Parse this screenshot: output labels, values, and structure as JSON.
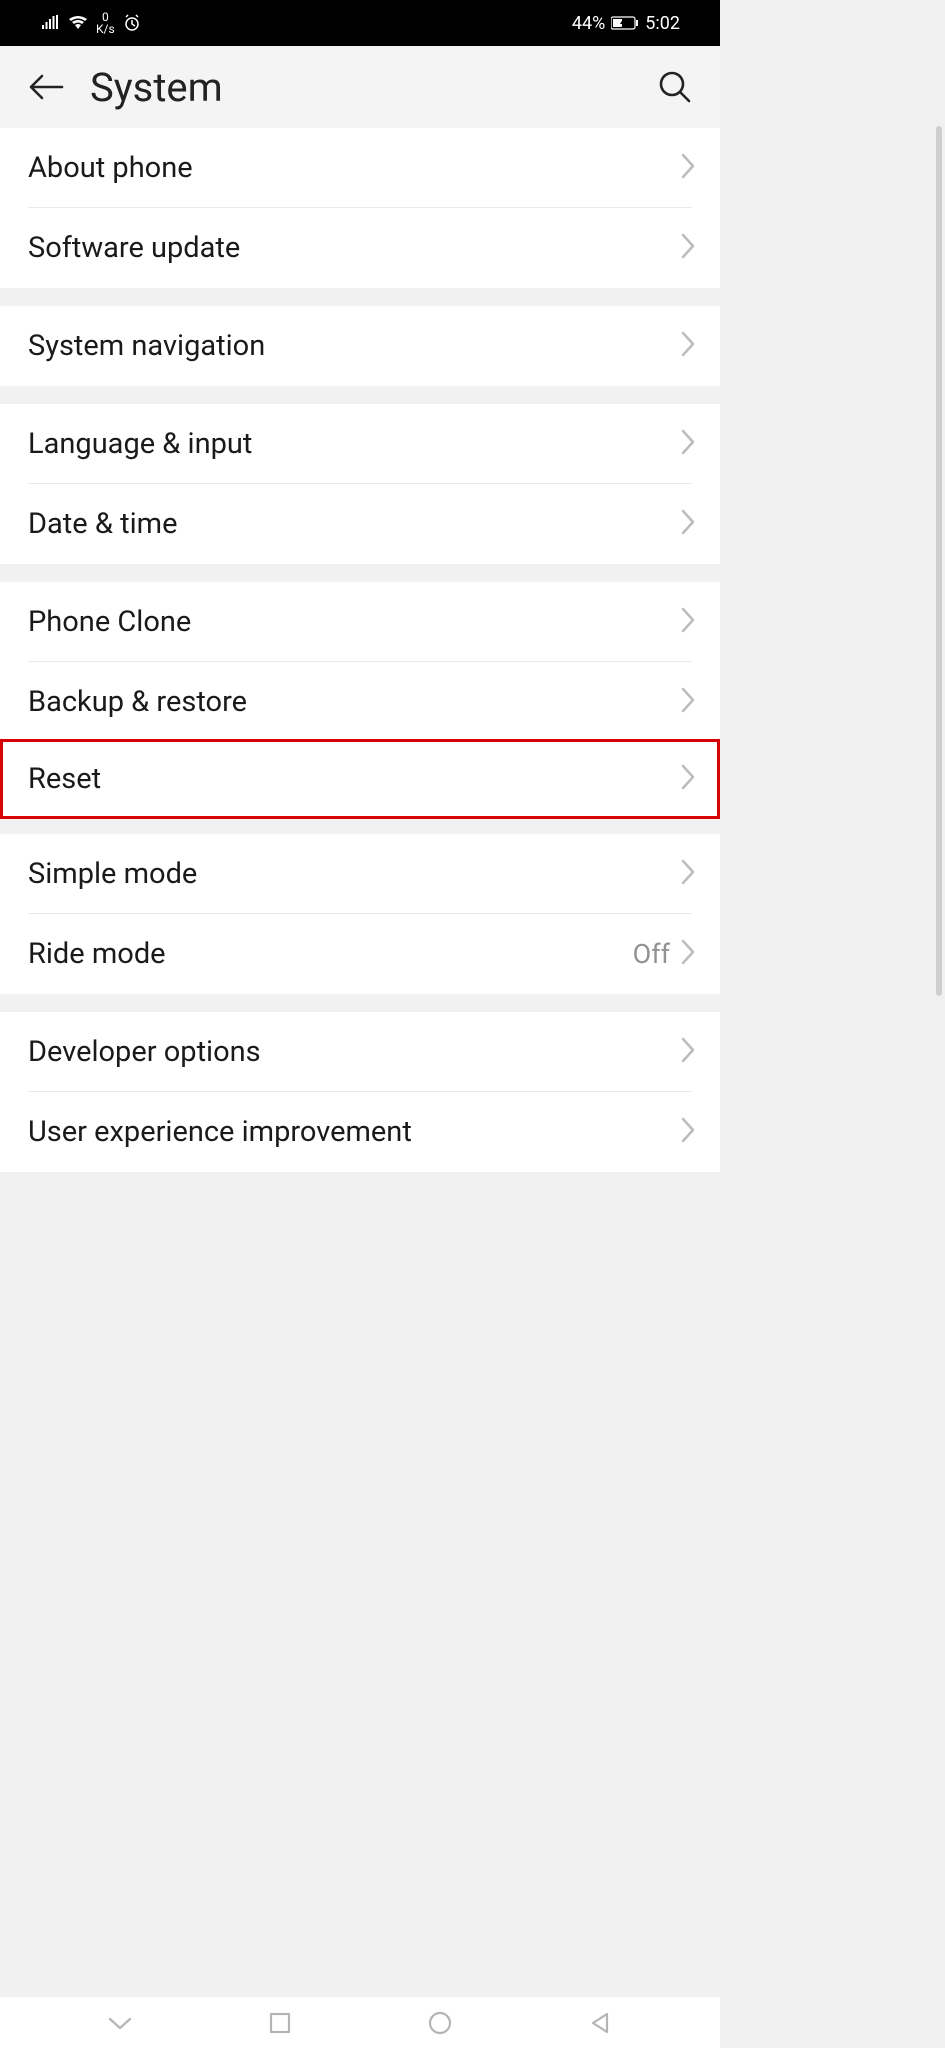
{
  "status_bar": {
    "speed_value": "0",
    "speed_unit": "K/s",
    "battery_percent": "44%",
    "time": "5:02"
  },
  "header": {
    "title": "System"
  },
  "groups": [
    {
      "items": [
        {
          "label": "About phone"
        },
        {
          "label": "Software update"
        }
      ]
    },
    {
      "items": [
        {
          "label": "System navigation"
        }
      ]
    },
    {
      "items": [
        {
          "label": "Language & input"
        },
        {
          "label": "Date & time"
        }
      ]
    },
    {
      "items": [
        {
          "label": "Phone Clone"
        },
        {
          "label": "Backup & restore"
        },
        {
          "label": "Reset"
        }
      ]
    },
    {
      "items": [
        {
          "label": "Simple mode"
        },
        {
          "label": "Ride mode",
          "value": "Off"
        }
      ]
    },
    {
      "items": [
        {
          "label": "Developer options"
        },
        {
          "label": "User experience improvement"
        }
      ]
    }
  ]
}
